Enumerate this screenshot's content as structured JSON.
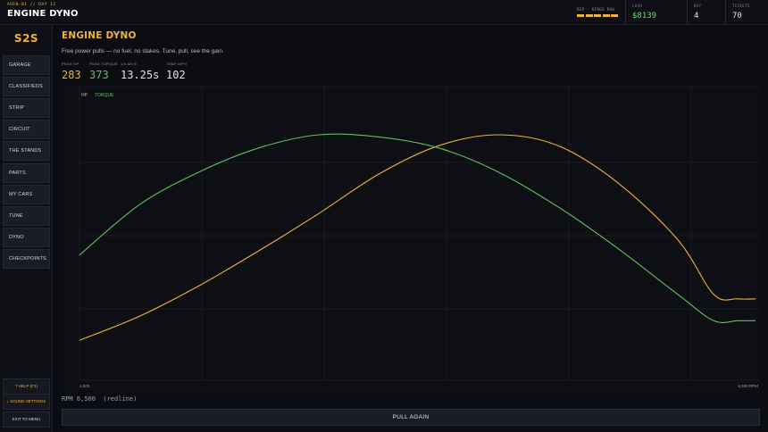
{
  "header": {
    "subtitle": "AREN-01 // DAY 12",
    "title": "ENGINE DYNO",
    "rep": {
      "label": "REP · KINGS ROW",
      "bars": 5
    },
    "stats": [
      {
        "label": "CASH",
        "value": "$8139"
      },
      {
        "label": "DAY",
        "value": "4"
      },
      {
        "label": "TICKETS",
        "value": "70"
      }
    ]
  },
  "sidebar": {
    "logo": "S2S",
    "items": [
      {
        "label": "GARAGE"
      },
      {
        "label": "CLASSIFIEDS"
      },
      {
        "label": "STRIP"
      },
      {
        "label": "CIRCUIT"
      },
      {
        "label": "THE STANDS"
      },
      {
        "label": "PARTS"
      },
      {
        "label": "MY CARS"
      },
      {
        "label": "TUNE"
      },
      {
        "label": "DYNO"
      },
      {
        "label": "CHECKPOINTS"
      }
    ],
    "help": "? HELP (F1)",
    "sound": "♪ SOUND SETTINGS",
    "exit": "EXIT TO MENU"
  },
  "main": {
    "title": "ENGINE DYNO",
    "description": "Free power pulls — no fuel, no stakes. Tune, pull, see the gain.",
    "metrics": [
      {
        "label": "PEAK HP",
        "value": "283"
      },
      {
        "label": "PEAK TORQUE",
        "value": "373"
      },
      {
        "label": "1/4 MILE",
        "value": "13.25s"
      },
      {
        "label": "TRAP MPH",
        "value": "102"
      }
    ],
    "rpm_readout": "RPM 6,500  (redline)",
    "pull_button": "PULL AGAIN"
  },
  "chart_data": {
    "type": "line",
    "x_tick_labels": [
      "1,000",
      "6,500 RPM"
    ],
    "xlim": [
      1000,
      6500
    ],
    "grid": true,
    "legend": "top-left",
    "series": [
      {
        "name": "HP",
        "color": "#f0b23c",
        "x": [
          1000,
          1500,
          2000,
          2500,
          3000,
          3500,
          4000,
          4500,
          5000,
          5500,
          6000,
          6300,
          6500
        ],
        "y": [
          0.06,
          0.17,
          0.31,
          0.47,
          0.64,
          0.82,
          0.95,
          1.0,
          0.95,
          0.78,
          0.52,
          0.27,
          0.25
        ]
      },
      {
        "name": "TORQUE",
        "color": "#5fc05f",
        "x": [
          1000,
          1500,
          2000,
          2500,
          3000,
          3500,
          4000,
          4500,
          5000,
          5500,
          6000,
          6300,
          6500
        ],
        "y": [
          0.45,
          0.68,
          0.83,
          0.94,
          1.0,
          0.99,
          0.94,
          0.83,
          0.67,
          0.48,
          0.27,
          0.15,
          0.15
        ]
      }
    ]
  }
}
